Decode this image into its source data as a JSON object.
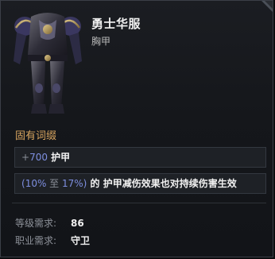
{
  "item": {
    "name": "勇士华服",
    "type": "胸甲",
    "icon": "chest-armor-icon"
  },
  "innate_affixes": {
    "title": "固有词缀",
    "affixes": [
      {
        "prefix": "+",
        "value": "700",
        "stat": " 护甲"
      },
      {
        "range_open": "(",
        "min": "10%",
        "to": " 至 ",
        "max": "17%",
        "range_close": ")",
        "text": " 的 护甲减伤效果也对持续伤害生效"
      }
    ]
  },
  "requirements": {
    "level_label": "等级需求:",
    "level_value": "86",
    "class_label": "职业需求:",
    "class_value": "守卫"
  },
  "colors": {
    "section_title": "#d7a45f",
    "value_blue": "#7e8fe0",
    "background": "#16181c",
    "border": "#3b3f47"
  }
}
